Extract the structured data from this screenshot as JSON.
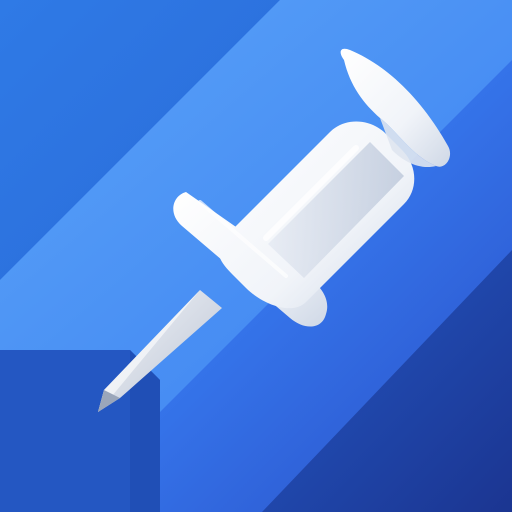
{
  "icon": {
    "name": "pushpin-icon",
    "colors": {
      "background_light": "#4f9bf7",
      "background_mid": "#2f6fe3",
      "background_dark": "#1d3f9a",
      "pin_body": "#ffffff",
      "pin_shade": "#c9d3e3",
      "needle": "#d9dee8"
    }
  }
}
